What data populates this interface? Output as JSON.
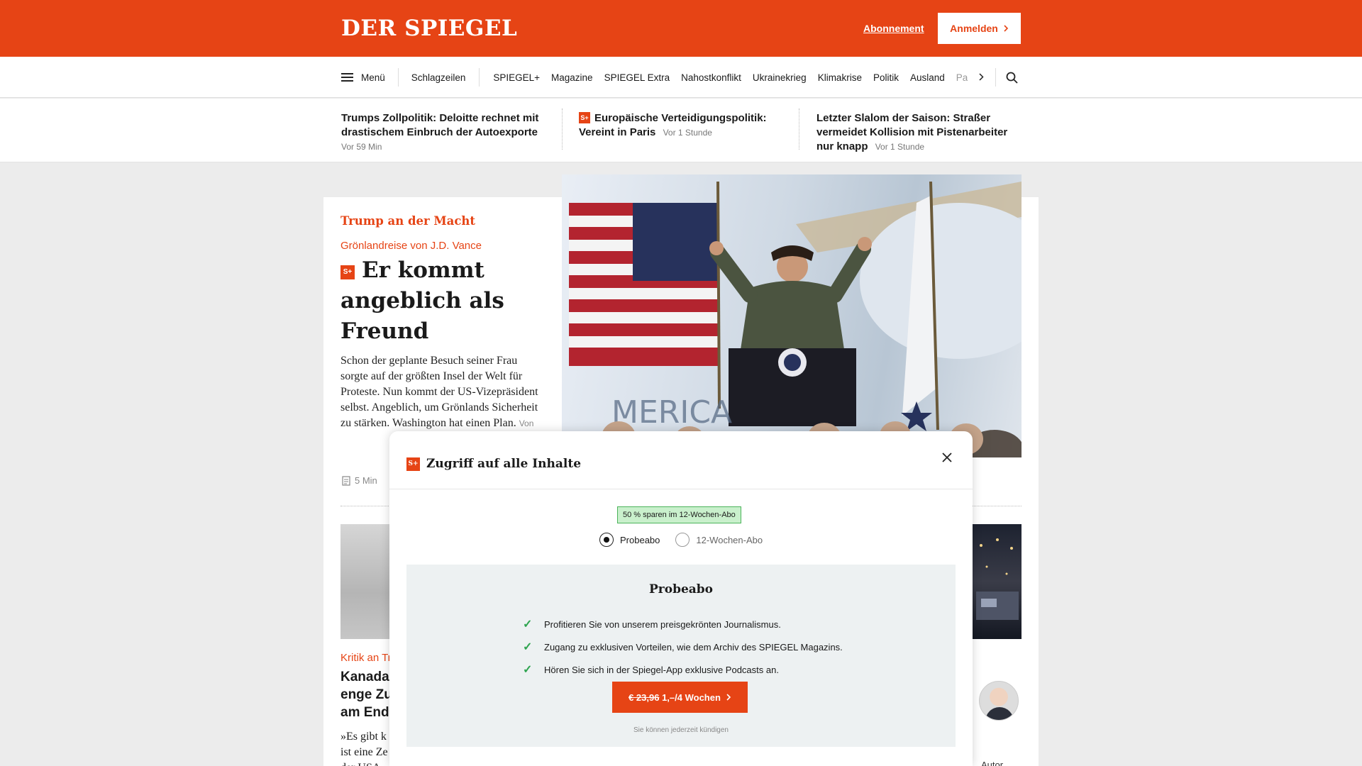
{
  "header": {
    "logo": "DER SPIEGEL",
    "subscribe_link": "Abonnement",
    "login_button": "Anmelden"
  },
  "nav": {
    "menu_label": "Menü",
    "first_item": "Schlagzeilen",
    "items": [
      "SPIEGEL+",
      "Magazine",
      "SPIEGEL Extra",
      "Nahostkonflikt",
      "Ukrainekrieg",
      "Klimakrise",
      "Politik",
      "Ausland",
      "Panorama"
    ]
  },
  "ticker": [
    {
      "title": "Trumps Zollpolitik: Deloitte rechnet mit drastischem Einbruch der Autoexporte",
      "time": "Vor 59 Min",
      "plus": false
    },
    {
      "title": "Europäische Verteidigungspolitik: Vereint in Paris",
      "time": "Vor 1 Stunde",
      "plus": true
    },
    {
      "title": "Letzter Slalom der Saison: Straßer vermeidet Kollision mit Pistenarbeiter nur knapp",
      "time": "Vor 1 Stunde",
      "plus": false
    }
  ],
  "lead": {
    "kicker": "Trump an der Macht",
    "subkicker": "Grönlandreise von J.D. Vance",
    "plus_badge": "S+",
    "headline": "Er kommt angeblich als Freund",
    "teaser": "Schon der geplante Besuch seiner Frau sorgte auf der größten Insel der Welt für Proteste. Nun kommt der US-Vizepräsident selbst. Angeblich, um Grönlands Sicherheit zu stärken. Washington hat einen Plan.",
    "teaser_time": "Von",
    "read_time": "5 Min"
  },
  "second": {
    "kicker": "Kritik an Tr",
    "headline_lines": [
      "Kanada",
      "enge Zu",
      "am End"
    ],
    "teaser_lines": [
      "»Es gibt k",
      "ist eine Ze",
      "der USA"
    ]
  },
  "author_caption": "Autor",
  "modal": {
    "plus_badge": "S+",
    "title": "Zugriff auf alle Inhalte",
    "promo_badge": "50 % sparen im 12-Wochen-Abo",
    "options": [
      "Probeabo",
      "12-Wochen-Abo"
    ],
    "selected_option": "Probeabo",
    "offer_title": "Probeabo",
    "benefits": [
      "Profitieren Sie von unserem preisgekrönten Journalismus.",
      "Zugang zu exklusiven Vorteilen, wie dem Archiv des SPIEGEL Magazins.",
      "Hören Sie sich in der Spiegel-App exklusive Podcasts an."
    ],
    "cta_old_price": "€ 23,96",
    "cta_new_price": "1,–/4 Wochen",
    "cancel_note": "Sie können jederzeit kündigen"
  },
  "colors": {
    "brand": "#e64415",
    "success": "#2ea44f"
  }
}
